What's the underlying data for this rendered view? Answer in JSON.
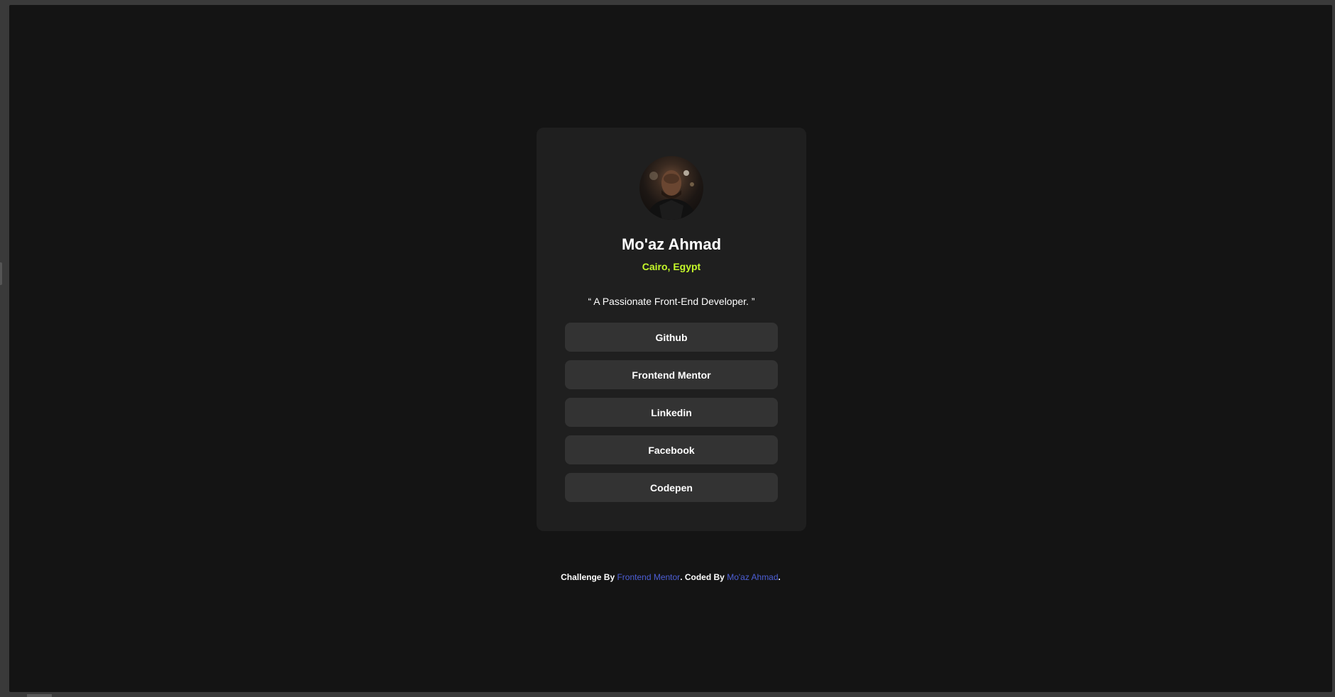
{
  "profile": {
    "name": "Mo'az Ahmad",
    "location": "Cairo, Egypt",
    "bio": "“ A Passionate Front-End Developer. ”"
  },
  "links": [
    {
      "label": "Github"
    },
    {
      "label": "Frontend Mentor"
    },
    {
      "label": "Linkedin"
    },
    {
      "label": "Facebook"
    },
    {
      "label": "Codepen"
    }
  ],
  "footer": {
    "challenge_prefix": "Challenge By ",
    "challenge_link": "Frontend Mentor",
    "coded_prefix": ". Coded By ",
    "coded_link": "Mo'az Ahmad",
    "suffix": "."
  },
  "colors": {
    "background": "#141414",
    "card": "#1f1f1f",
    "button": "#333333",
    "accent_green": "#c4f82a",
    "link_blue": "#4d5fd6"
  }
}
